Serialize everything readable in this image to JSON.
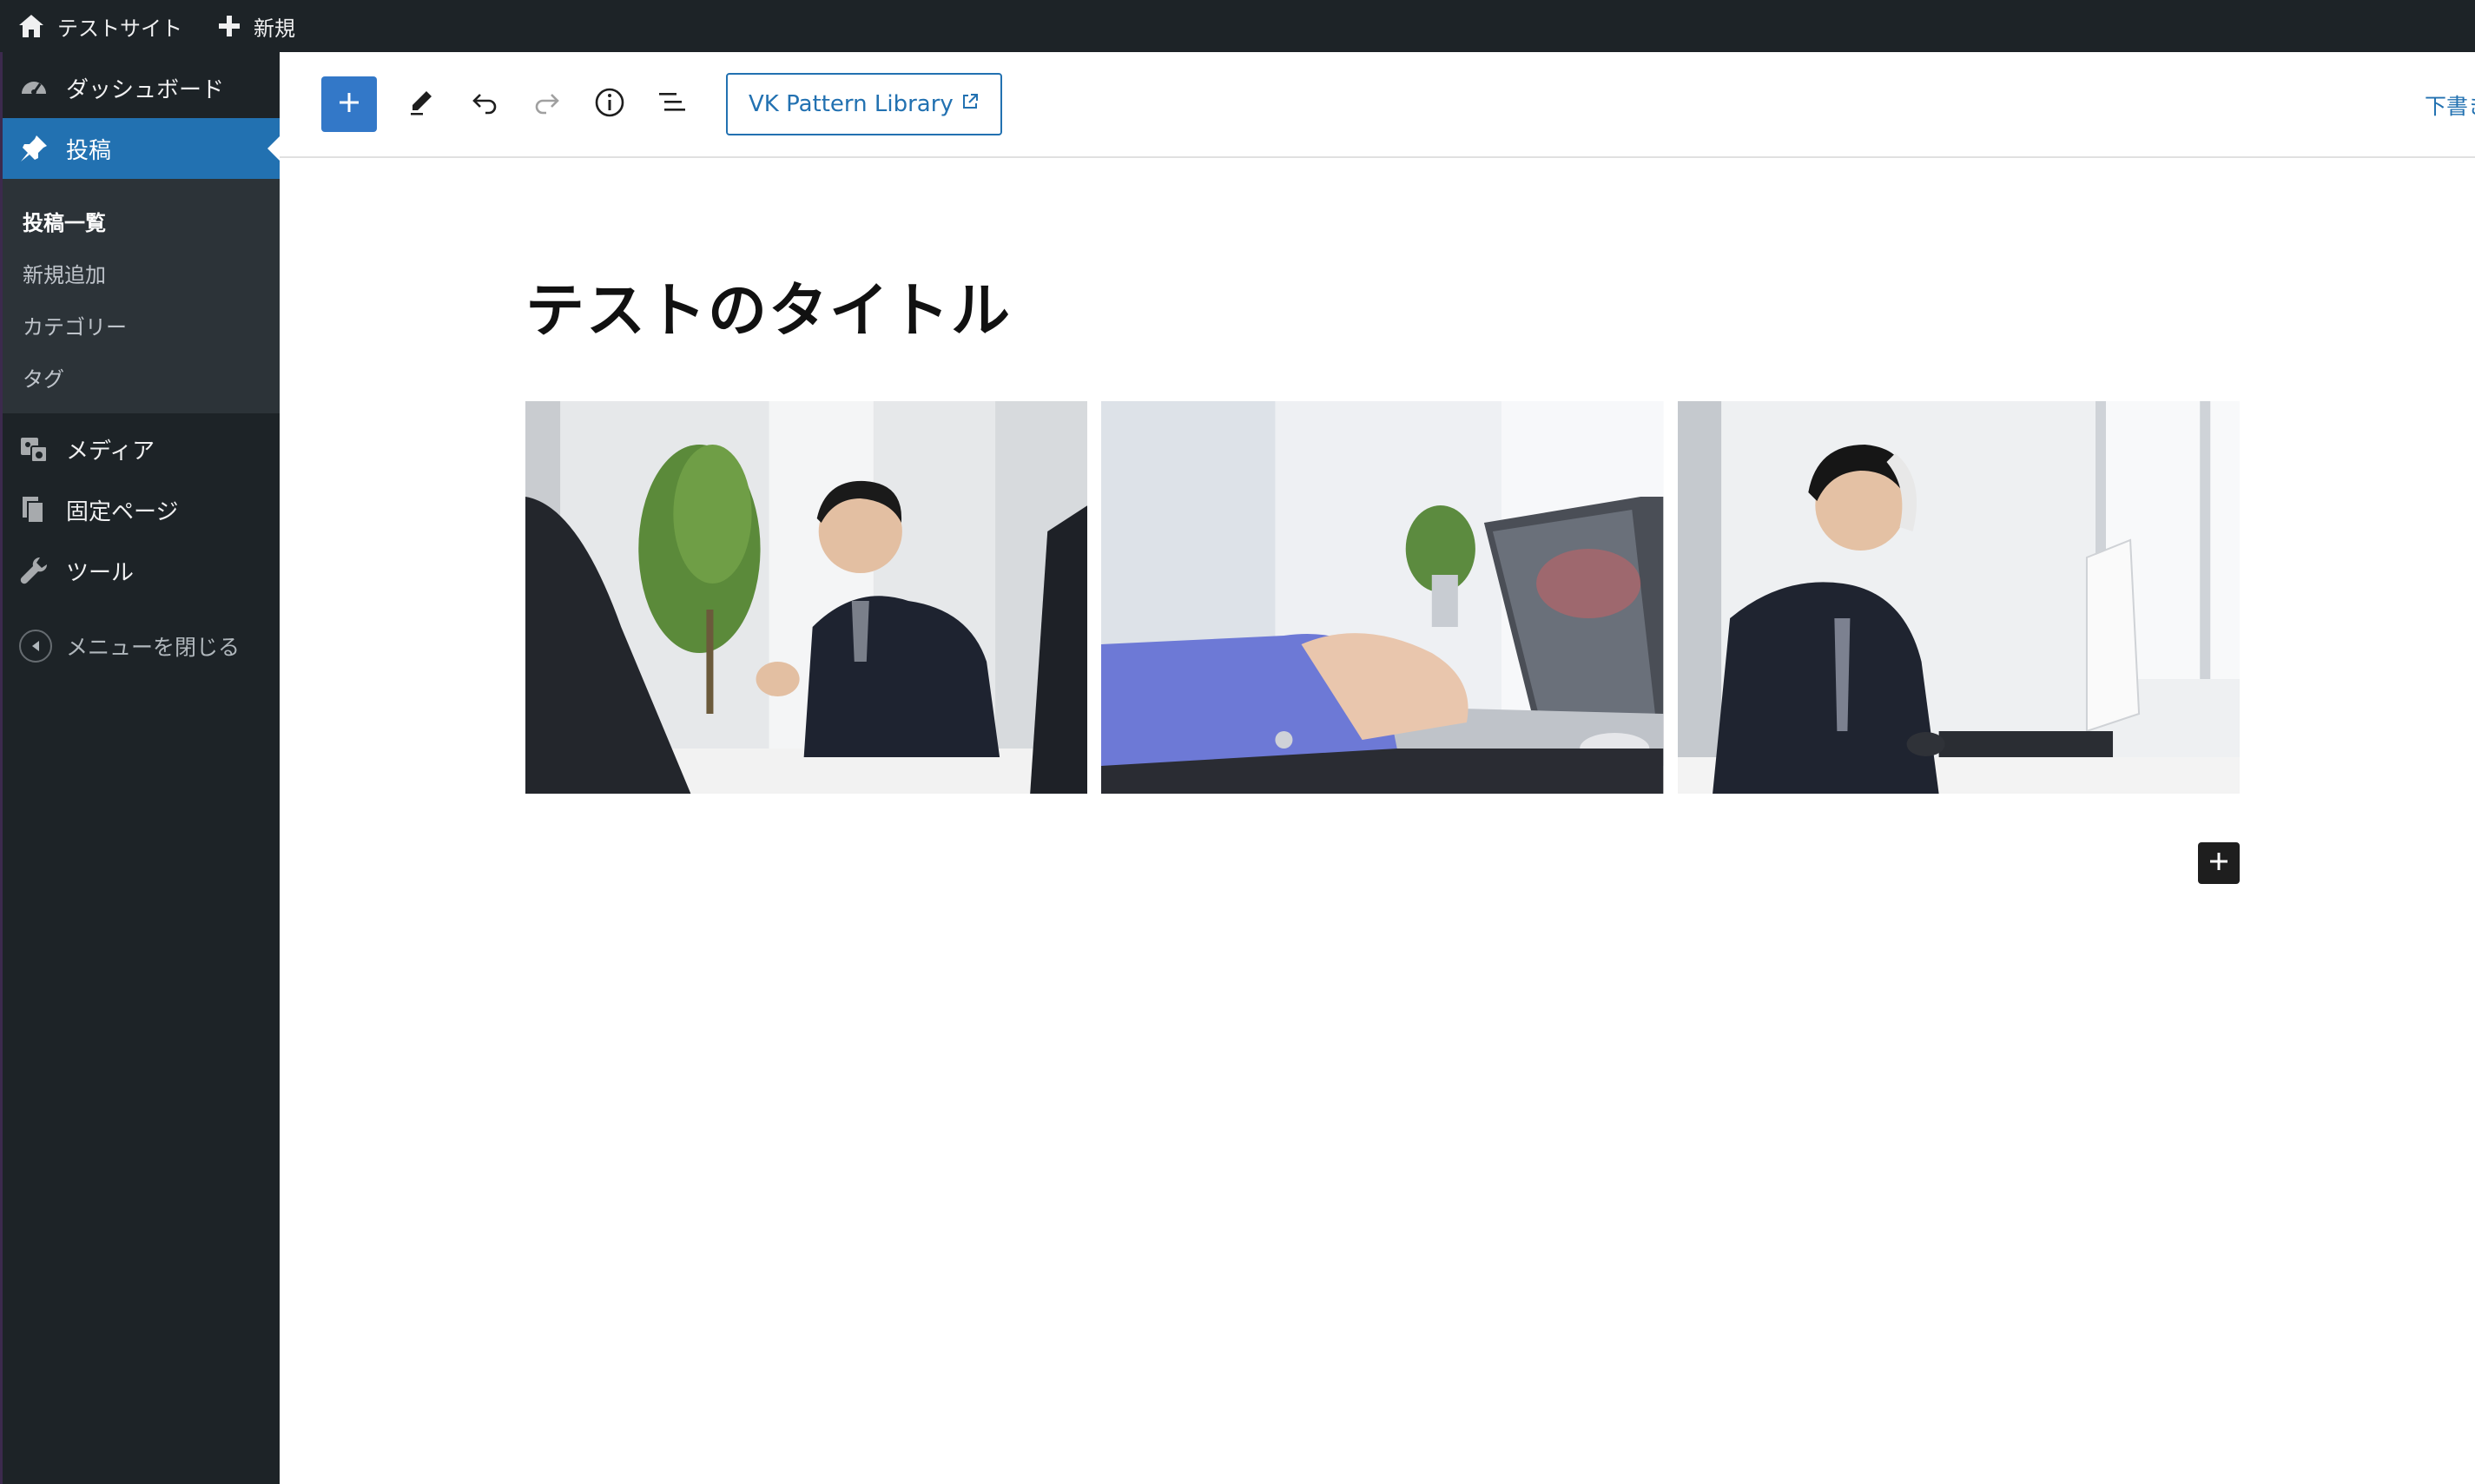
{
  "admin_bar": {
    "site_name": "テストサイト",
    "new_label": "新規"
  },
  "sidebar": {
    "items": [
      {
        "label": "ダッシュボード",
        "icon": "dashboard-icon"
      },
      {
        "label": "投稿",
        "icon": "pin-icon",
        "current": true
      },
      {
        "label": "メディア",
        "icon": "media-icon"
      },
      {
        "label": "固定ページ",
        "icon": "pages-icon"
      },
      {
        "label": "ツール",
        "icon": "wrench-icon"
      }
    ],
    "submenu": [
      {
        "label": "投稿一覧",
        "current": true
      },
      {
        "label": "新規追加"
      },
      {
        "label": "カテゴリー"
      },
      {
        "label": "タグ"
      }
    ],
    "collapse_label": "メニューを閉じる"
  },
  "toolbar": {
    "tools": [
      "add-block-icon",
      "edit-icon",
      "undo-icon",
      "redo-icon",
      "info-icon",
      "list-view-icon"
    ],
    "vk_label": "VK Pattern Library",
    "save_draft_label": "下書き保存"
  },
  "post": {
    "title": "テストのタイトル"
  },
  "gallery": {
    "images": [
      "meeting-photo",
      "laptop-typing-photo",
      "phone-call-photo"
    ]
  },
  "colors": {
    "admin_dark": "#1d2327",
    "accent_blue": "#2271b1",
    "toolbar_blue": "#3378c8"
  }
}
